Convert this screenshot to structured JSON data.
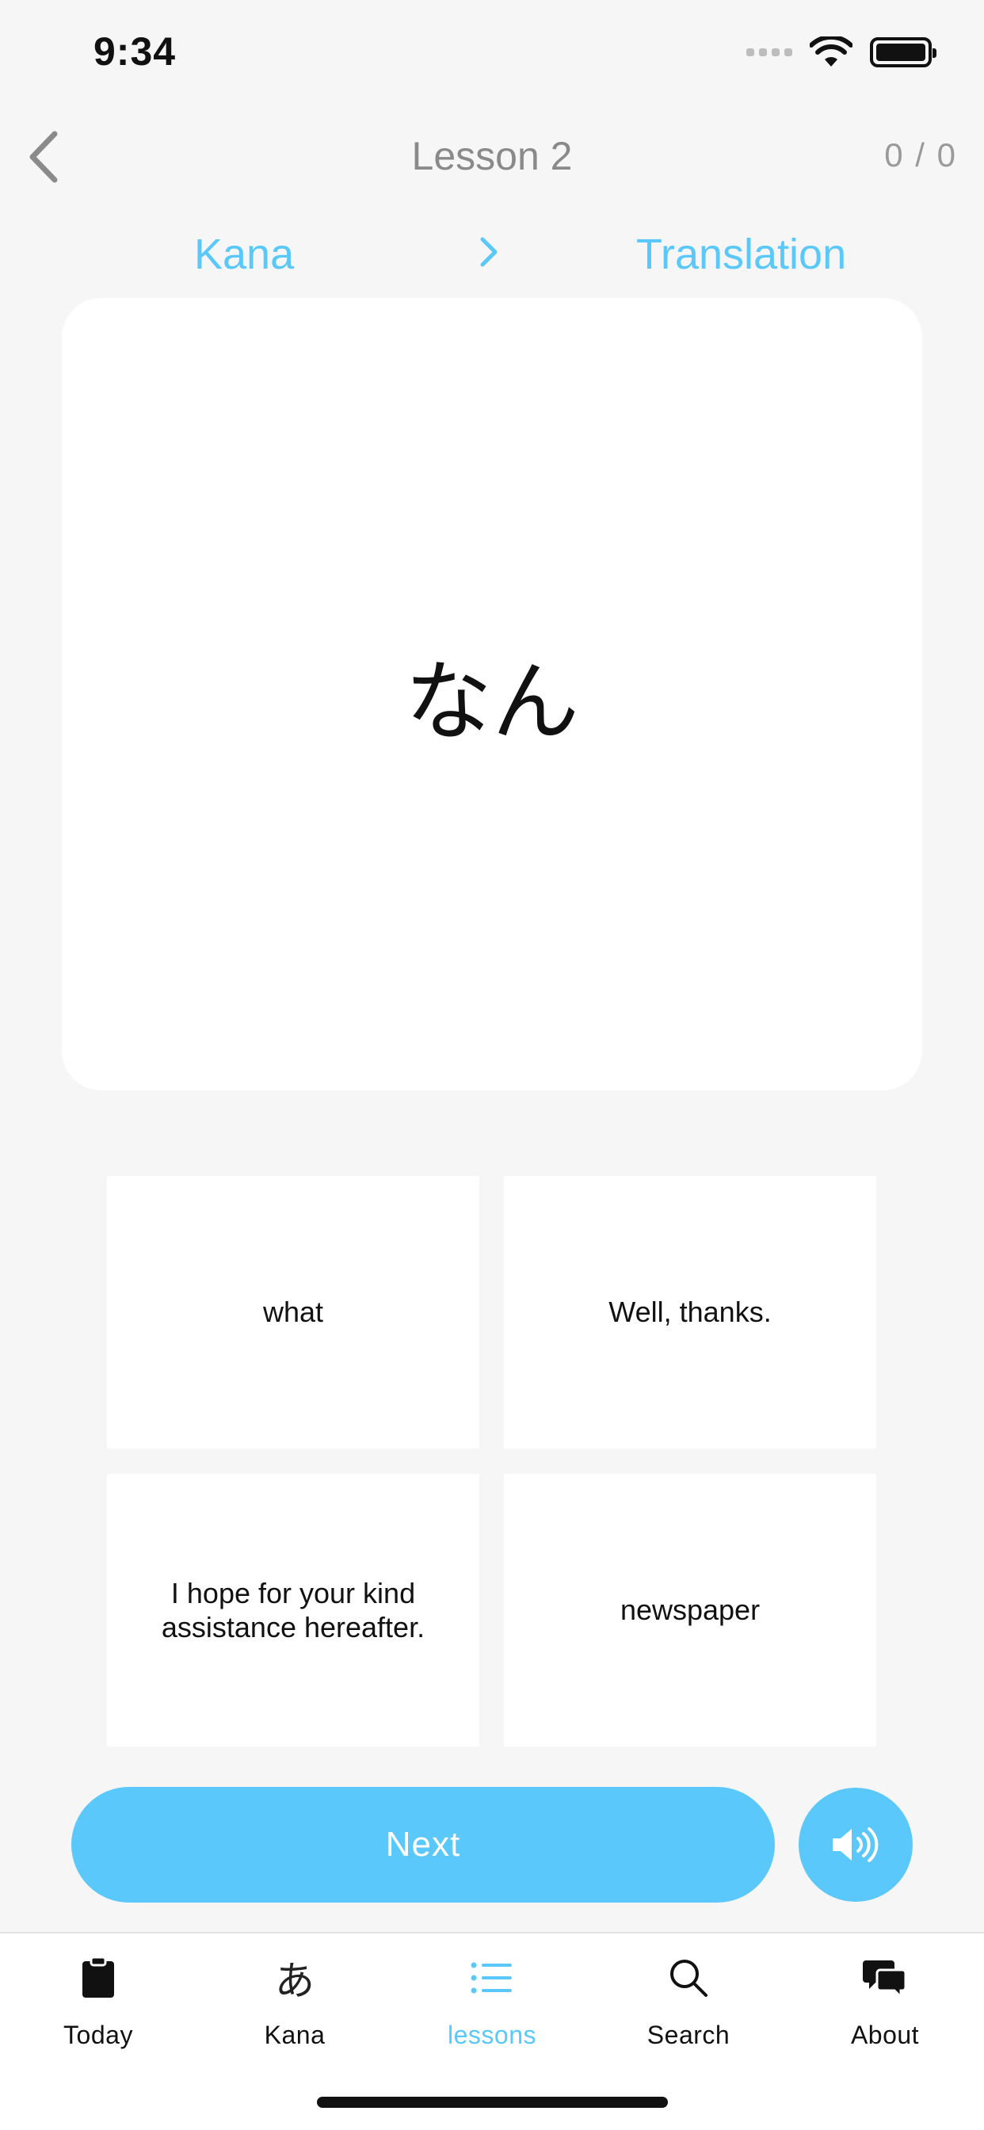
{
  "status_bar": {
    "time": "9:34"
  },
  "nav": {
    "title": "Lesson 2",
    "progress": "0 / 0"
  },
  "mode": {
    "from": "Kana",
    "to": "Translation"
  },
  "card": {
    "text": "なん"
  },
  "options": [
    {
      "label": "what"
    },
    {
      "label": "Well, thanks."
    },
    {
      "label": "I hope for your kind assistance hereafter."
    },
    {
      "label": "newspaper"
    }
  ],
  "actions": {
    "next_label": "Next",
    "sound_icon": "speaker-icon"
  },
  "tabbar": {
    "active_color": "#5ac8fa",
    "tabs": [
      {
        "label": "Today",
        "icon": "clipboard-icon"
      },
      {
        "label": "Kana",
        "icon": "kana-glyph-icon",
        "glyph": "あ"
      },
      {
        "label": "lessons",
        "icon": "list-icon",
        "active": true
      },
      {
        "label": "Search",
        "icon": "search-icon"
      },
      {
        "label": "About",
        "icon": "chat-bubbles-icon"
      }
    ]
  }
}
